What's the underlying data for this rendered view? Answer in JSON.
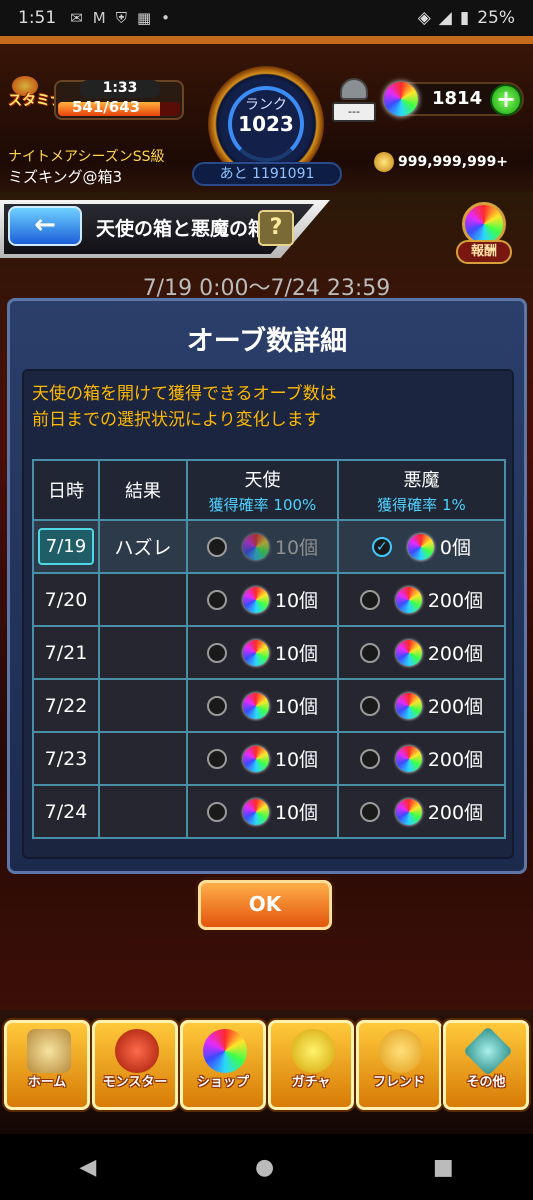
{
  "status_bar": {
    "time": "1:51",
    "battery": "25%"
  },
  "header": {
    "stamina_label": "スタミナ",
    "stamina_timer": "1:33",
    "stamina_value": "541/643",
    "stamina_fraction": 0.84,
    "rank_label": "ランク",
    "rank_value": "1023",
    "rank_next": "あと 1191091",
    "robot_display": "---",
    "orb_count": "1814",
    "plus_label": "+",
    "season": "ナイトメアシーズンSS級",
    "player_name": "ミズキング@箱3",
    "gold": "999,999,999+"
  },
  "screen": {
    "title": "天使の箱と悪魔の箱",
    "back_label": "←",
    "help_label": "?",
    "reward_label": "報酬",
    "period": "7/19 0:00〜7/24 23:59"
  },
  "panel": {
    "title": "オーブ数詳細",
    "info_line1": "天使の箱を開けて獲得できるオーブ数は",
    "info_line2": "前日までの選択状況により変化します",
    "headers": {
      "date": "日時",
      "result": "結果",
      "angel": "天使",
      "angel_rate": "獲得確率 100%",
      "devil": "悪魔",
      "devil_rate": "獲得確率 1%"
    },
    "rows": [
      {
        "date": "7/19",
        "result": "ハズレ",
        "angel": "10個",
        "devil": "0個"
      },
      {
        "date": "7/20",
        "result": "",
        "angel": "10個",
        "devil": "200個"
      },
      {
        "date": "7/21",
        "result": "",
        "angel": "10個",
        "devil": "200個"
      },
      {
        "date": "7/22",
        "result": "",
        "angel": "10個",
        "devil": "200個"
      },
      {
        "date": "7/23",
        "result": "",
        "angel": "10個",
        "devil": "200個"
      },
      {
        "date": "7/24",
        "result": "",
        "angel": "10個",
        "devil": "200個"
      }
    ],
    "ok_label": "OK"
  },
  "nav": {
    "home": "ホーム",
    "monster": "モンスター",
    "shop": "ショップ",
    "gacha": "ガチャ",
    "friend": "フレンド",
    "other": "その他"
  },
  "colors": {
    "accent_orange": "#e2550c",
    "info_yellow": "#ffb800",
    "rate_blue": "#4fd0ff"
  }
}
